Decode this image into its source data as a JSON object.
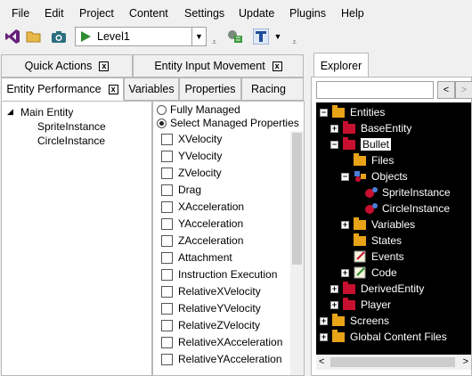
{
  "menu": [
    "File",
    "Edit",
    "Project",
    "Content",
    "Settings",
    "Update",
    "Plugins",
    "Help"
  ],
  "toolbar": {
    "combo_value": "Level1"
  },
  "tabs_row1": [
    "Quick Actions",
    "Entity Input Movement"
  ],
  "tabs_row2": [
    "Entity Performance",
    "Variables",
    "Properties",
    "Racing"
  ],
  "tree": {
    "root": "Main Entity",
    "children": [
      "SpriteInstance",
      "CircleInstance"
    ]
  },
  "radios": [
    {
      "label": "Fully Managed",
      "selected": false
    },
    {
      "label": "Select Managed Properties",
      "selected": true
    }
  ],
  "checkboxes": [
    "XVelocity",
    "YVelocity",
    "ZVelocity",
    "Drag",
    "XAcceleration",
    "YAcceleration",
    "ZAcceleration",
    "Attachment",
    "Instruction Execution",
    "RelativeXVelocity",
    "RelativeYVelocity",
    "RelativeZVelocity",
    "RelativeXAcceleration",
    "RelativeYAcceleration"
  ],
  "explorer": {
    "tab": "Explorer",
    "items": [
      {
        "label": "Entities",
        "icon": "folder-gold",
        "expander": "minus"
      },
      {
        "label": "BaseEntity",
        "icon": "folder-red",
        "expander": "plus"
      },
      {
        "label": "Bullet",
        "icon": "folder-red",
        "expander": "minus",
        "selected": true
      },
      {
        "label": "Files",
        "icon": "folder-gold",
        "expander": ""
      },
      {
        "label": "Objects",
        "icon": "objects-icon",
        "expander": "minus"
      },
      {
        "label": "SpriteInstance",
        "icon": "sprite-icon",
        "expander": ""
      },
      {
        "label": "CircleInstance",
        "icon": "circle-icon",
        "expander": ""
      },
      {
        "label": "Variables",
        "icon": "folder-gold",
        "expander": "plus"
      },
      {
        "label": "States",
        "icon": "folder-gold",
        "expander": ""
      },
      {
        "label": "Events",
        "icon": "events-icon",
        "expander": ""
      },
      {
        "label": "Code",
        "icon": "code-icon",
        "expander": "plus"
      },
      {
        "label": "DerivedEntity",
        "icon": "folder-red",
        "expander": "plus"
      },
      {
        "label": "Player",
        "icon": "folder-red",
        "expander": "plus"
      },
      {
        "label": "Screens",
        "icon": "folder-gold",
        "expander": "plus"
      },
      {
        "label": "Global Content Files",
        "icon": "folder-gold",
        "expander": "plus"
      }
    ]
  },
  "colors": {
    "tree_bg": "#000000",
    "folder_red": "#c8102e",
    "folder_gold": "#e8a317",
    "play_green": "#2e8b2e",
    "vs_purple": "#68217a"
  }
}
